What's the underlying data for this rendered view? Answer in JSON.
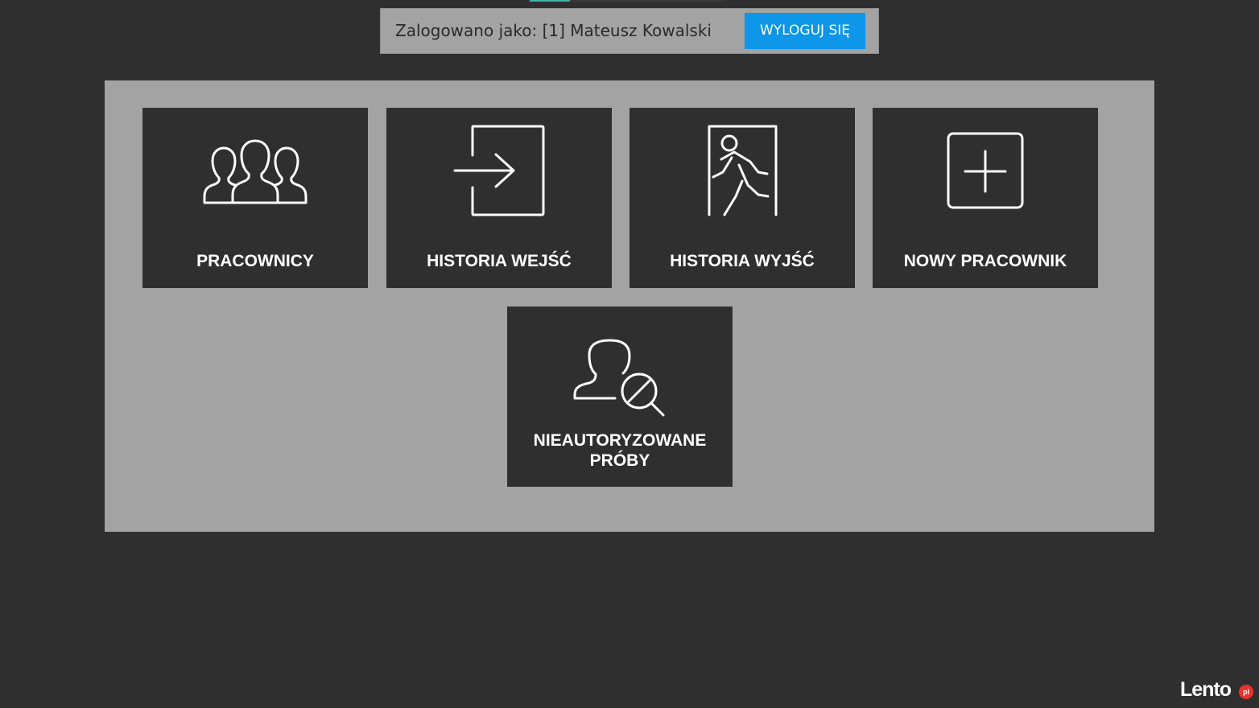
{
  "header": {
    "logged_in_text": "Zalogowano jako: [1] Mateusz Kowalski",
    "logout_label": "WYLOGUJ SIĘ"
  },
  "tiles": [
    {
      "label": "PRACOWNICY",
      "icon": "users-group-icon"
    },
    {
      "label": "HISTORIA WEJŚĆ",
      "icon": "sign-in-icon"
    },
    {
      "label": "HISTORIA WYJŚĆ",
      "icon": "emergency-exit-icon"
    },
    {
      "label": "NOWY PRACOWNIK",
      "icon": "add-square-icon"
    },
    {
      "label": "NIEAUTORYZOWANE PRÓBY",
      "icon": "user-search-blocked-icon"
    }
  ],
  "watermark": {
    "brand": "Lento",
    "badge": "pl"
  },
  "colors": {
    "background": "#2f2f2f",
    "panel": "#a3a3a3",
    "tile": "#2f2f2f",
    "accent": "#0e96e8"
  }
}
